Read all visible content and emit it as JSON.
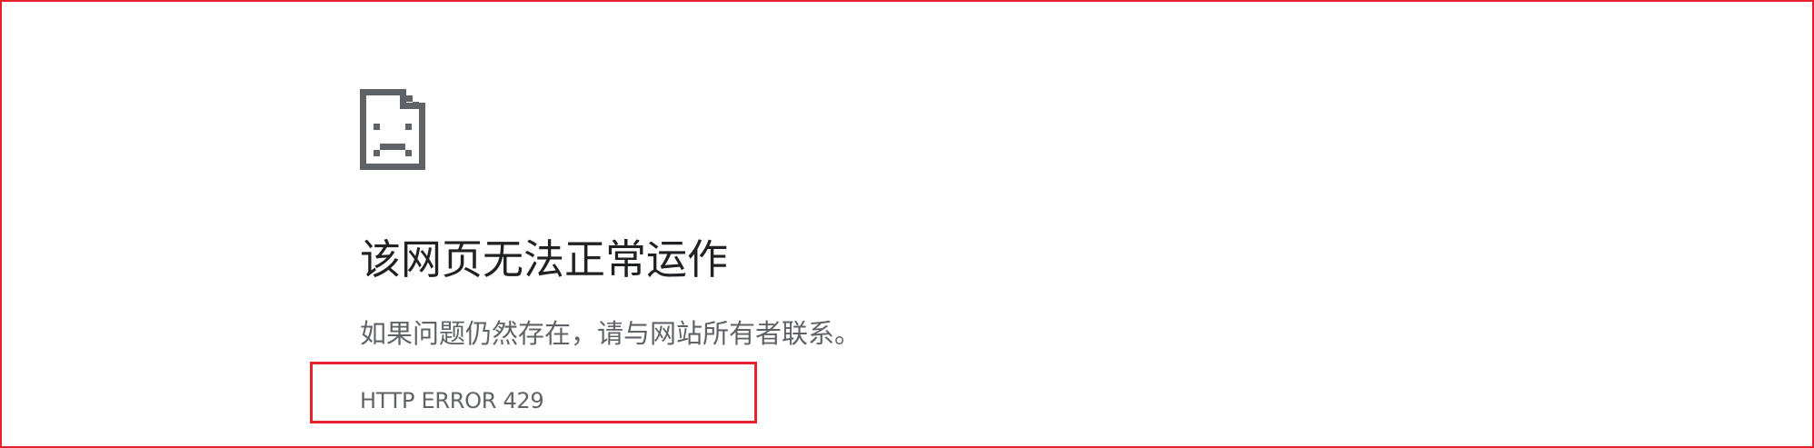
{
  "error_page": {
    "icon": "sad-document-icon",
    "title": "该网页无法正常运作",
    "message": "如果问题仍然存在，请与网站所有者联系。",
    "error_code": "HTTP ERROR 429"
  },
  "colors": {
    "frame": "#e8202a",
    "highlight_box": "#e8202a",
    "icon": "#5f6368",
    "title": "#202124",
    "body_text": "#5f6368"
  }
}
